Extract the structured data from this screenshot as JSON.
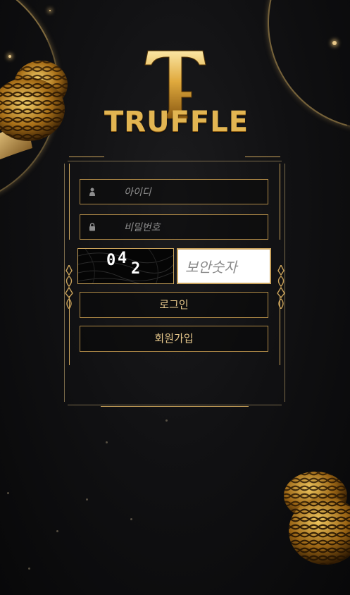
{
  "brand": {
    "logo_letter": "T",
    "name": "TRUFFLE"
  },
  "login_form": {
    "id_placeholder": "아이디",
    "password_placeholder": "비밀번호",
    "captcha_digits": [
      "0",
      "4",
      "2"
    ],
    "security_placeholder": "보안숫자",
    "login_label": "로그인",
    "signup_label": "회원가입"
  },
  "colors": {
    "gold": "#c9a25a",
    "button_text": "#e8c98c",
    "background": "#111113"
  },
  "icons": {
    "id_field": "user-icon",
    "password_field": "lock-icon"
  }
}
